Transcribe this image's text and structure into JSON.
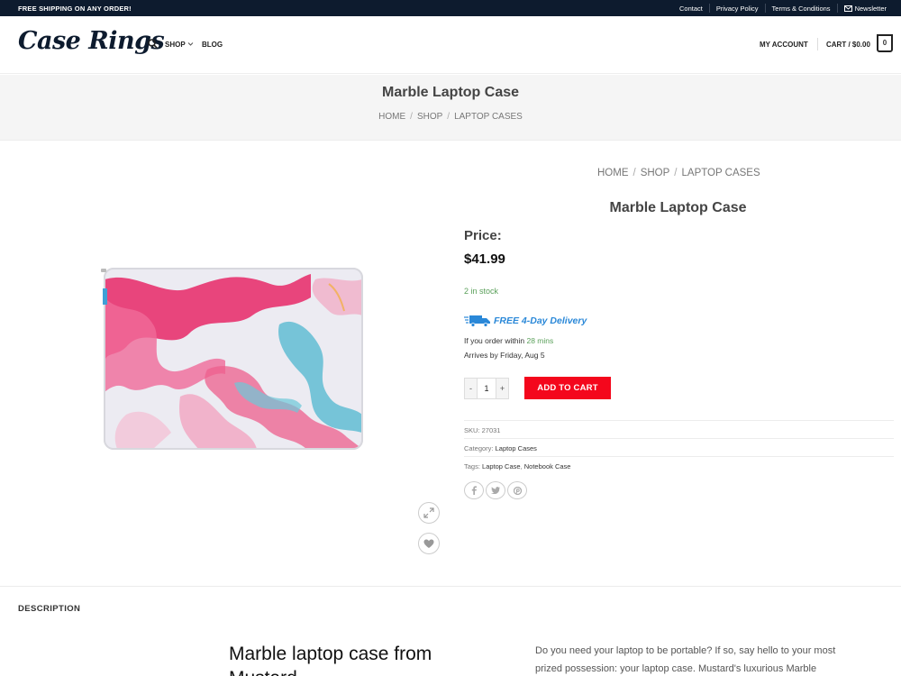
{
  "topbar": {
    "promo": "FREE SHIPPING ON ANY ORDER!",
    "links": [
      "Contact",
      "Privacy Policy",
      "Terms & Conditions"
    ],
    "newsletter": "Newsletter"
  },
  "header": {
    "logo": "Case Rings",
    "nav_shop": "SHOP",
    "nav_blog": "BLOG",
    "account": "MY ACCOUNT",
    "cart": "CART / $0.00",
    "cart_count": "0"
  },
  "titleband": {
    "title": "Marble Laptop Case",
    "crumbs": [
      "HOME",
      "SHOP",
      "LAPTOP CASES"
    ]
  },
  "product": {
    "crumbs": [
      "HOME",
      "SHOP",
      "LAPTOP CASES"
    ],
    "title": "Marble Laptop Case",
    "price_label": "Price:",
    "price": "$41.99",
    "stock": "2 in stock",
    "delivery": "FREE 4-Day Delivery",
    "order_within_prefix": "If you order within",
    "order_within_time": "28 mins",
    "arrives": "Arrives by Friday, Aug 5",
    "qty_minus": "-",
    "qty": "1",
    "qty_plus": "+",
    "add_to_cart": "ADD TO CART",
    "sku_label": "SKU:",
    "sku": "27031",
    "category_label": "Category:",
    "category": "Laptop Cases",
    "tags_label": "Tags:",
    "tag1": "Laptop Case",
    "tag2": "Notebook Case"
  },
  "description": {
    "tab": "DESCRIPTION",
    "heading": "Marble laptop case from Mustard",
    "text": "Do you need your laptop to be portable? If so, say hello to your most prized possession: your laptop case. Mustard's luxurious Marble"
  },
  "colors": {
    "topbar_bg": "#0d1b2e",
    "add_to_cart": "#f4071c",
    "delivery_blue": "#2a88d8",
    "stock_green": "#5aa05a"
  }
}
